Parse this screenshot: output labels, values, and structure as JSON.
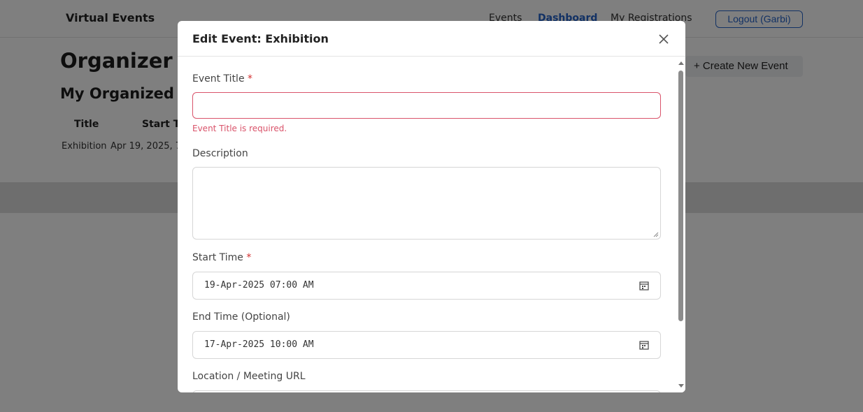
{
  "navbar": {
    "brand": "Virtual Events",
    "links": [
      {
        "label": "Events"
      },
      {
        "label": "Dashboard"
      },
      {
        "label": "My Registrations"
      }
    ],
    "logout_label": "Logout (Garbi)"
  },
  "page": {
    "title": "Organizer Dashboard",
    "section_title": "My Organized Events",
    "create_button": "+ Create New Event",
    "table": {
      "headers": [
        "Title",
        "Start Time"
      ],
      "rows": [
        {
          "title": "Exhibition",
          "start": "Apr 19, 2025, 7"
        }
      ]
    }
  },
  "modal": {
    "title": "Edit Event: Exhibition",
    "fields": {
      "event_title": {
        "label": "Event Title",
        "required": "*",
        "value": "",
        "error": "Event Title is required."
      },
      "description": {
        "label": "Description",
        "value": ""
      },
      "start_time": {
        "label": "Start Time",
        "required": "*",
        "value": "19-Apr-2025 07:00 AM"
      },
      "end_time": {
        "label": "End Time (Optional)",
        "value": "17-Apr-2025 10:00 AM"
      },
      "location": {
        "label": "Location / Meeting URL",
        "value": ""
      }
    }
  },
  "colors": {
    "accent": "#2563c9",
    "error": "#d9536a",
    "overlay": "rgba(0,0,0,0.5)"
  }
}
